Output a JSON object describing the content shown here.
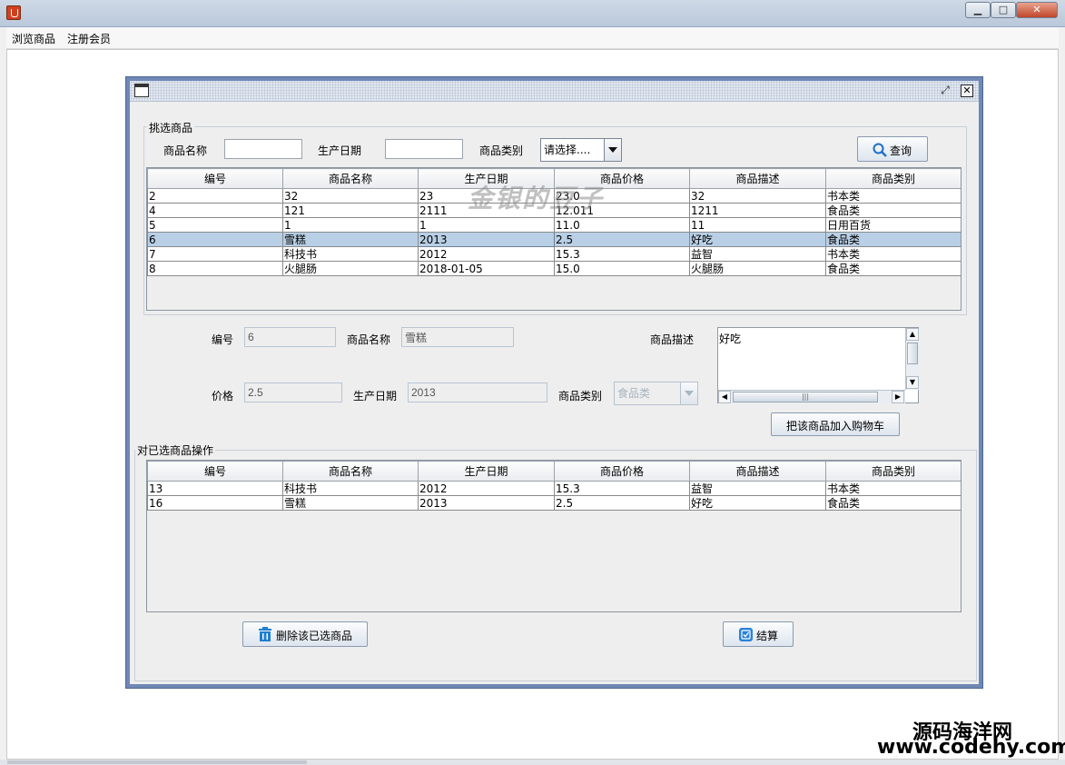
{
  "window": {
    "title": "",
    "minimize": "▁",
    "maximize": "□",
    "close": "✕"
  },
  "menu": [
    {
      "label": "浏览商品"
    },
    {
      "label": "注册会员"
    }
  ],
  "internal_frame": {
    "restore_symbol": "⤢",
    "close_symbol": "✕"
  },
  "select_section": {
    "title": "挑选商品",
    "name_label": "商品名称",
    "name_value": "",
    "date_label": "生产日期",
    "date_value": "",
    "category_label": "商品类别",
    "category_value": "请选择....",
    "query_button": "查询",
    "watermark": "金银的豆子"
  },
  "columns": [
    "编号",
    "商品名称",
    "生产日期",
    "商品价格",
    "商品描述",
    "商品类别"
  ],
  "products": [
    {
      "id": "2",
      "name": "32",
      "date": "23",
      "price": "23.0",
      "desc": "32",
      "category": "书本类"
    },
    {
      "id": "4",
      "name": "121",
      "date": "2111",
      "price": "12.011",
      "desc": "1211",
      "category": "食品类"
    },
    {
      "id": "5",
      "name": "1",
      "date": "1",
      "price": "11.0",
      "desc": "11",
      "category": "日用百货"
    },
    {
      "id": "6",
      "name": "雪糕",
      "date": "2013",
      "price": "2.5",
      "desc": "好吃",
      "category": "食品类"
    },
    {
      "id": "7",
      "name": "科技书",
      "date": "2012",
      "price": "15.3",
      "desc": "益智",
      "category": "书本类"
    },
    {
      "id": "8",
      "name": "火腿肠",
      "date": "2018-01-05",
      "price": "15.0",
      "desc": "火腿肠",
      "category": "食品类"
    }
  ],
  "selected_row_index": 3,
  "detail": {
    "id_label": "编号",
    "id_value": "6",
    "name_label": "商品名称",
    "name_value": "雪糕",
    "desc_label": "商品描述",
    "desc_value": "好吃",
    "price_label": "价格",
    "price_value": "2.5",
    "date_label": "生产日期",
    "date_value": "2013",
    "category_label": "商品类别",
    "category_value": "食品类",
    "add_cart_button": "把该商品加入购物车"
  },
  "cart_section": {
    "title": "对已选商品操作",
    "items": [
      {
        "id": "13",
        "name": "科技书",
        "date": "2012",
        "price": "15.3",
        "desc": "益智",
        "category": "书本类"
      },
      {
        "id": "16",
        "name": "雪糕",
        "date": "2013",
        "price": "2.5",
        "desc": "好吃",
        "category": "食品类"
      }
    ],
    "delete_button": "删除该已选商品",
    "checkout_button": "结算"
  },
  "branding": {
    "logo_text": "源码海洋网",
    "url_text": "www.codehy.com"
  },
  "colors": {
    "frame_border": "#6f88b6",
    "selected_row": "#b8cfe5",
    "query_icon": "#1e6fc4",
    "delete_icon": "#1f7fd0",
    "checkout_icon": "#2a82d8"
  },
  "icons": {
    "query": "search-icon",
    "delete": "trash-icon",
    "checkout": "checkout-icon"
  }
}
